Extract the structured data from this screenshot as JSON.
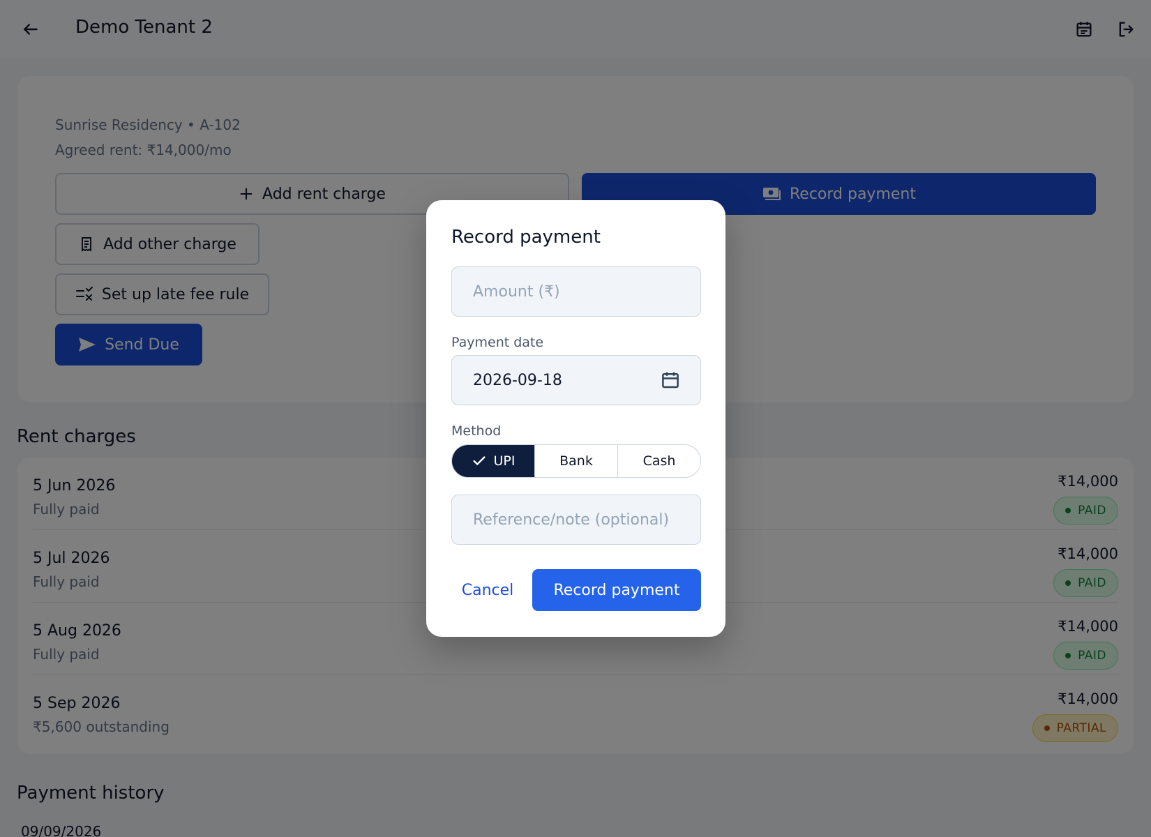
{
  "appbar": {
    "title": "Demo Tenant 2",
    "back_icon": "arrow-left-icon",
    "calendar_icon": "calendar-icon",
    "logout_icon": "logout-icon"
  },
  "tenant": {
    "property_line": "Sunrise Residency • A-102",
    "rent_line": "Agreed rent: ₹14,000/mo"
  },
  "actions": {
    "add_rent_charge": "Add rent charge",
    "record_payment": "Record payment",
    "add_other_charge": "Add other charge",
    "late_fee_rule": "Set up late fee rule",
    "send_due": "Send Due"
  },
  "rent_charges": {
    "title": "Rent charges",
    "items": [
      {
        "date": "5 Jun 2026",
        "status": "Fully paid",
        "amount": "₹14,000",
        "badge": "PAID"
      },
      {
        "date": "5 Jul 2026",
        "status": "Fully paid",
        "amount": "₹14,000",
        "badge": "PAID"
      },
      {
        "date": "5 Aug 2026",
        "status": "Fully paid",
        "amount": "₹14,000",
        "badge": "PAID"
      },
      {
        "date": "5 Sep 2026",
        "status": "₹5,600 outstanding",
        "amount": "₹14,000",
        "badge": "PARTIAL"
      }
    ]
  },
  "payment_history": {
    "title": "Payment history",
    "first_date": "09/09/2026"
  },
  "dialog": {
    "title": "Record payment",
    "amount_placeholder": "Amount (₹)",
    "date_label": "Payment date",
    "date_value": "2026-09-18",
    "method_label": "Method",
    "methods": [
      "UPI",
      "Bank",
      "Cash"
    ],
    "selected_method": "UPI",
    "reference_placeholder": "Reference/note (optional)",
    "cancel": "Cancel",
    "submit": "Record payment"
  },
  "colors": {
    "primary": "#2563eb",
    "primary_dark": "#1d4ed8",
    "selected_segment": "#0f1e3d",
    "paid": "#15803d",
    "partial": "#b45309"
  }
}
